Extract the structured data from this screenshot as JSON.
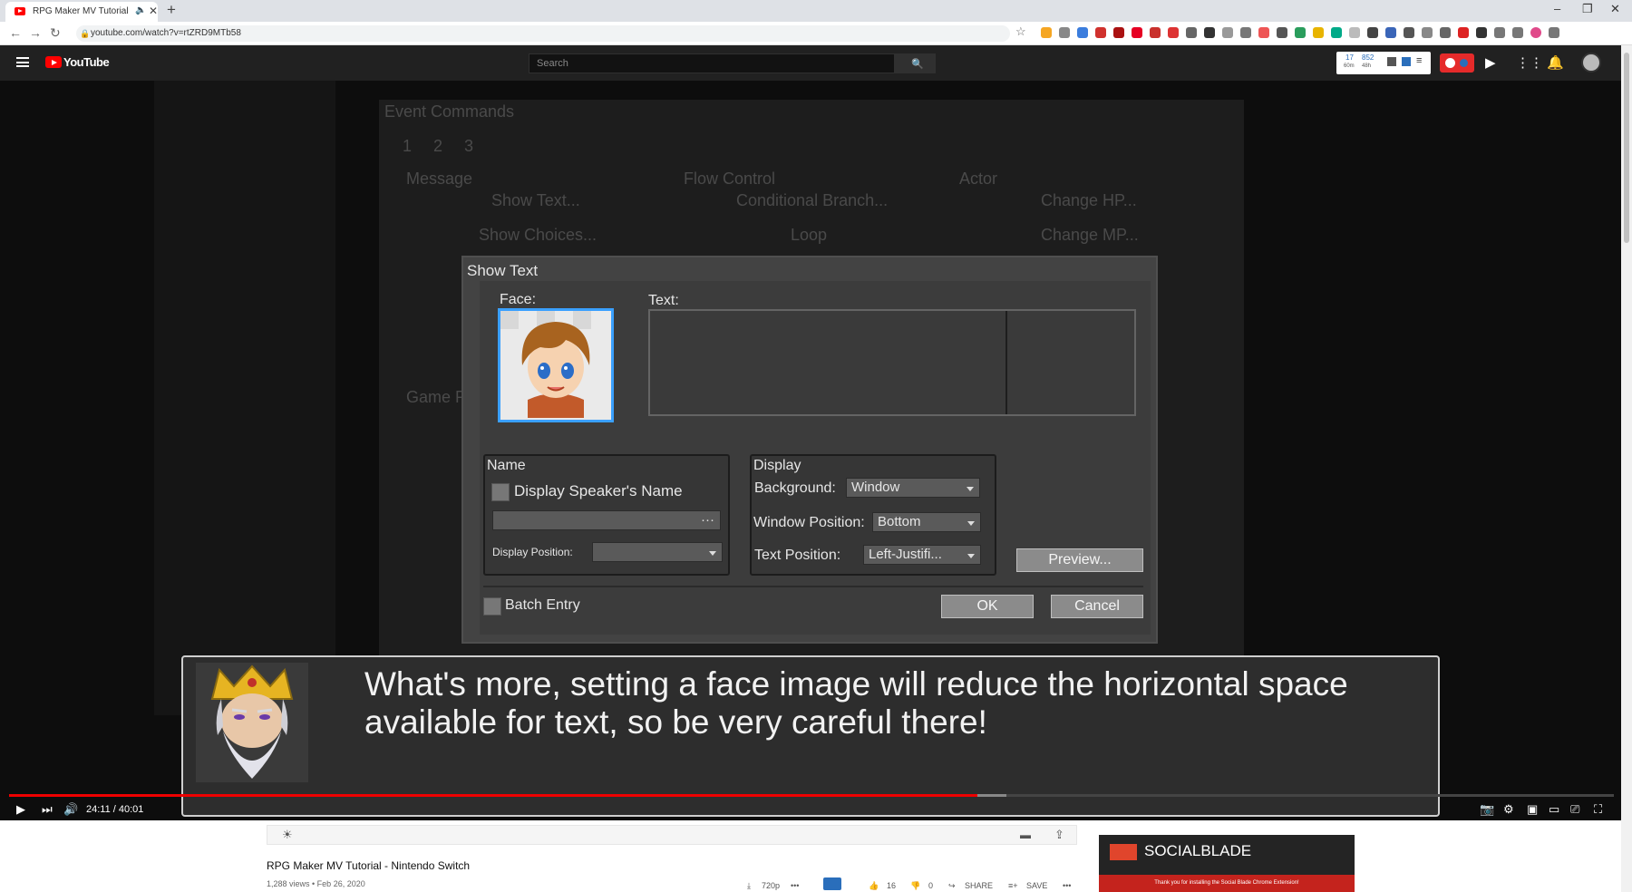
{
  "browser": {
    "tab_title": "RPG Maker MV Tutorial - Ni",
    "url": "youtube.com/watch?v=rtZRD9MTb58",
    "new_tab": "+",
    "close": "✕"
  },
  "youtube": {
    "brand": "YouTube",
    "search_placeholder": "Search",
    "stats": {
      "a": "17",
      "a_sub": "60m",
      "b": "852",
      "b_sub": "48h"
    }
  },
  "video": {
    "bg": {
      "event_commands": "Event Commands",
      "tabs": [
        "1",
        "2",
        "3"
      ],
      "sections": [
        "Message",
        "Flow Control",
        "Actor",
        "Game P"
      ],
      "buttons": [
        "Show Text...",
        "Conditional Branch...",
        "Change HP...",
        "Show Choices...",
        "Loop",
        "Change MP..."
      ]
    },
    "dialog": {
      "title": "Show Text",
      "face_label": "Face:",
      "text_label": "Text:",
      "name_group": "Name",
      "display_speaker": "Display Speaker's Name",
      "display_position": "Display Position:",
      "display_group": "Display",
      "background_label": "Background:",
      "background_value": "Window",
      "window_position_label": "Window Position:",
      "window_position_value": "Bottom",
      "text_position_label": "Text Position:",
      "text_position_value": "Left-Justifi...",
      "preview": "Preview...",
      "batch_entry": "Batch Entry",
      "ok": "OK",
      "cancel": "Cancel"
    },
    "subtitle": "What's more, setting a face image will reduce the horizontal space available for text, so be very careful there!",
    "time": "24:11 / 40:01",
    "progress": 0.604
  },
  "page": {
    "title": "RPG Maker MV Tutorial - Nintendo Switch",
    "meta": "1,288 views • Feb 26, 2020",
    "quality": "720p",
    "likes": "16",
    "dislikes": "0",
    "share": "SHARE",
    "save": "SAVE",
    "socialblade": "SOCIALBLADE",
    "socialblade_note": "Thank you for installing the Social Blade Chrome Extension!"
  },
  "colors": {
    "accent": "#ff0000",
    "highlight": "#3aa0ff"
  }
}
